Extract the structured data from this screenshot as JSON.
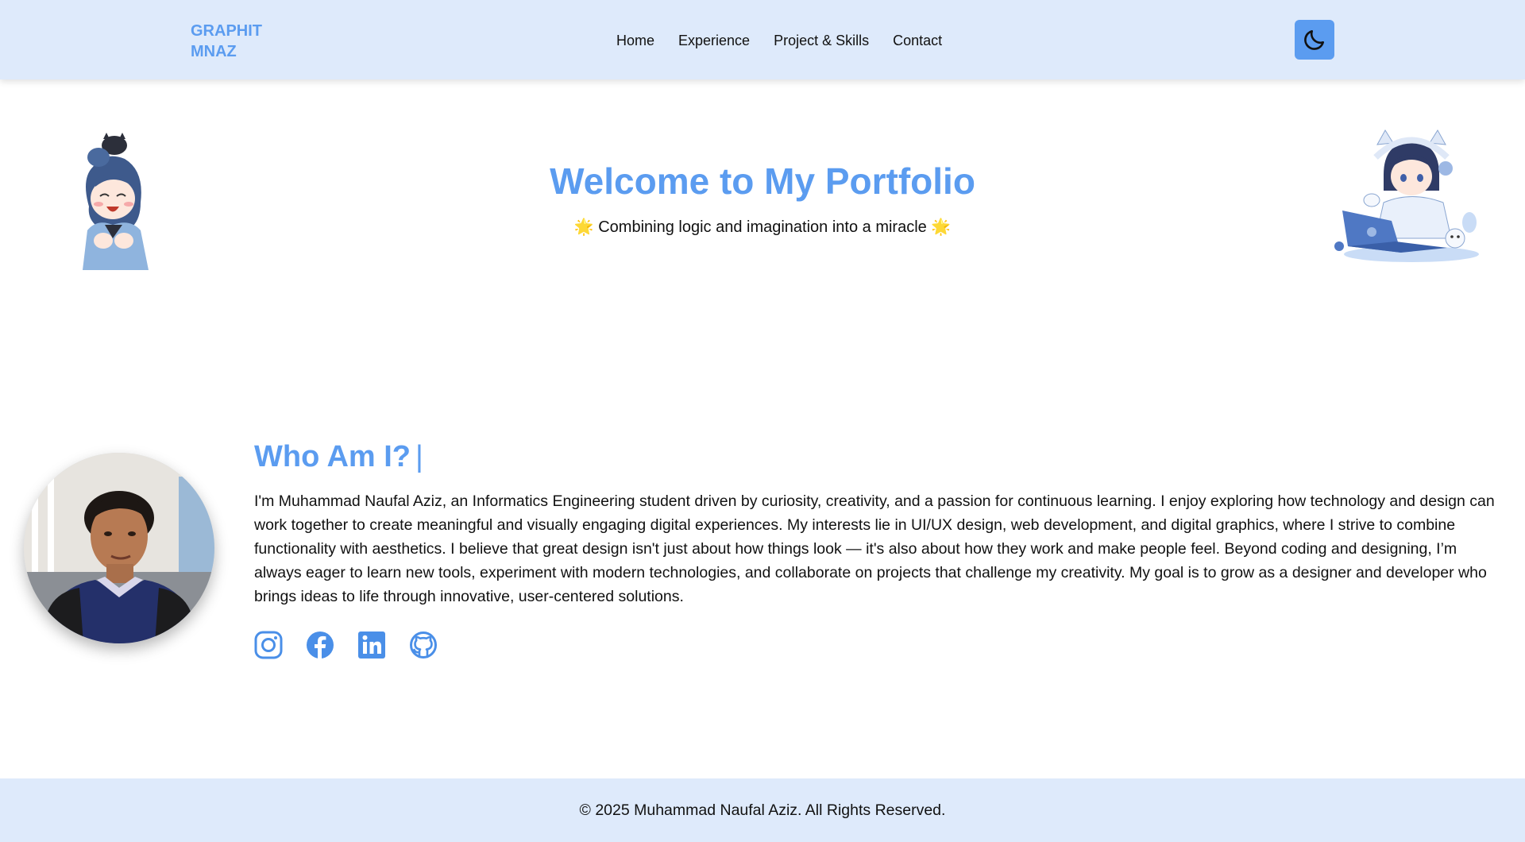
{
  "header": {
    "brand_line1": "GRAPHIT",
    "brand_line2": "MNAZ",
    "nav": [
      "Home",
      "Experience",
      "Project & Skills",
      "Contact"
    ],
    "theme_toggle_icon": "moon-icon"
  },
  "hero": {
    "title": "Welcome to My Portfolio",
    "sun_left": "🌟",
    "subtitle": "Combining logic and imagination into a miracle",
    "sun_right": "🌟"
  },
  "about": {
    "title": "Who Am I?",
    "cursor": "|",
    "text": "I'm Muhammad Naufal Aziz, an Informatics Engineering student driven by curiosity, creativity, and a passion for continuous learning. I enjoy exploring how technology and design can work together to create meaningful and visually engaging digital experiences. My interests lie in UI/UX design, web development, and digital graphics, where I strive to combine functionality with aesthetics. I believe that great design isn't just about how things look — it's also about how they work and make people feel. Beyond coding and designing, I’m always eager to learn new tools, experiment with modern technologies, and collaborate on projects that challenge my creativity. My goal is to grow as a designer and developer who brings ideas to life through innovative, user-centered solutions.",
    "socials": [
      "instagram-icon",
      "facebook-icon",
      "linkedin-icon",
      "github-icon"
    ]
  },
  "footer": {
    "copyright": "© 2025 Muhammad Naufal Aziz. All Rights Reserved."
  },
  "colors": {
    "accent": "#5b9cf0",
    "header_bg": "#deeafb",
    "footer_bg": "#deeafb"
  }
}
